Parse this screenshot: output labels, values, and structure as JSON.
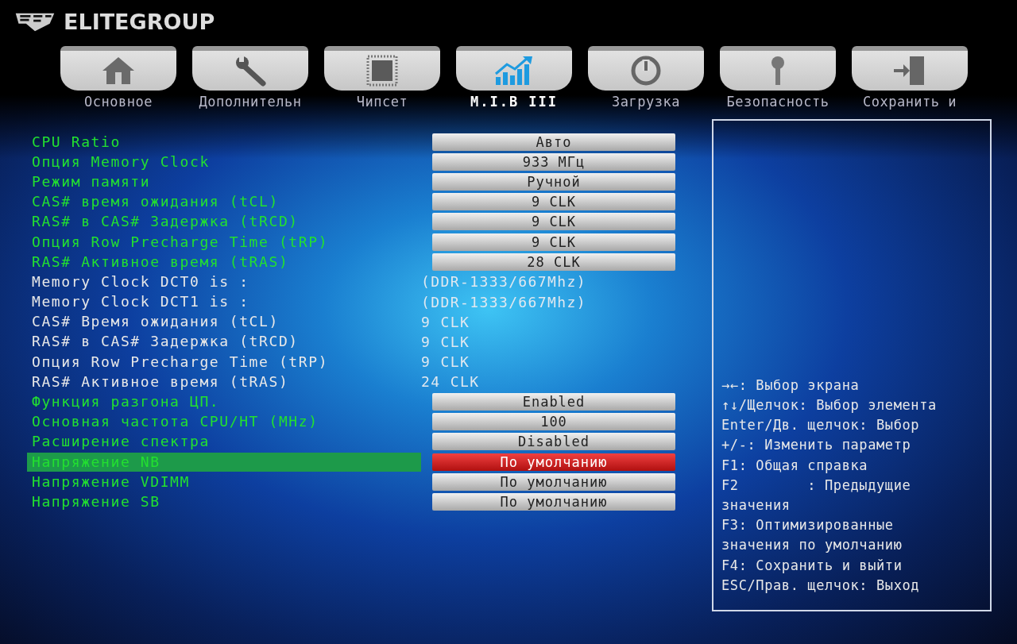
{
  "brand": {
    "name": "ELITEGROUP"
  },
  "tabs": [
    {
      "label": "Основное",
      "selected": false
    },
    {
      "label": "Дополнительн",
      "selected": false
    },
    {
      "label": "Чипсет",
      "selected": false
    },
    {
      "label": "M.I.B III",
      "selected": true
    },
    {
      "label": "Загрузка",
      "selected": false
    },
    {
      "label": "Безопасность",
      "selected": false
    },
    {
      "label": "Сохранить и",
      "selected": false
    }
  ],
  "settings": [
    {
      "kind": "option",
      "label": "CPU Ratio",
      "value": "Авто",
      "selected": false
    },
    {
      "kind": "option",
      "label": "Опция Memory Clock",
      "value": "933 МГц",
      "selected": false
    },
    {
      "kind": "option",
      "label": "Режим памяти",
      "value": "Ручной",
      "selected": false
    },
    {
      "kind": "option",
      "label": "CAS# время ожидания (tCL)",
      "value": "9 CLK",
      "selected": false
    },
    {
      "kind": "option",
      "label": "RAS# в CAS# Задержка (tRCD)",
      "value": "9 CLK",
      "selected": false
    },
    {
      "kind": "option",
      "label": "Опция Row Precharge Time (tRP)",
      "value": "9 CLK",
      "selected": false
    },
    {
      "kind": "option",
      "label": "RAS# Активное время (tRAS)",
      "value": "28 CLK",
      "selected": false
    },
    {
      "kind": "info",
      "label": "Memory Clock DCT0 is :",
      "value": "(DDR-1333/667Mhz)",
      "selected": false
    },
    {
      "kind": "info",
      "label": "Memory Clock DCT1 is :",
      "value": "(DDR-1333/667Mhz)",
      "selected": false
    },
    {
      "kind": "info",
      "label": "CAS# Время ожидания (tCL)",
      "value": "9 CLK",
      "selected": false
    },
    {
      "kind": "info",
      "label": "RAS# в CAS# Задержка (tRCD)",
      "value": "9 CLK",
      "selected": false
    },
    {
      "kind": "info",
      "label": "Опция Row Precharge Time (tRP)",
      "value": "9 CLK",
      "selected": false
    },
    {
      "kind": "info",
      "label": "RAS# Активное время (tRAS)",
      "value": "24 CLK",
      "selected": false
    },
    {
      "kind": "option",
      "label": "Функция разгона ЦП.",
      "value": "Enabled",
      "selected": false
    },
    {
      "kind": "option",
      "label": "Основная частота CPU/HT (MHz)",
      "value": "100",
      "selected": false
    },
    {
      "kind": "option",
      "label": "Расширение спектра",
      "value": "Disabled",
      "selected": false
    },
    {
      "kind": "option",
      "label": "Напряжение NB",
      "value": "По умолчанию",
      "selected": true
    },
    {
      "kind": "option",
      "label": "Напряжение VDIMM",
      "value": "По умолчанию",
      "selected": false
    },
    {
      "kind": "option",
      "label": "Напряжение SB",
      "value": "По умолчанию",
      "selected": false
    }
  ],
  "help": [
    "→←: Выбор экрана",
    "↑↓/Щелчок: Выбор элемента",
    "Enter/Дв. щелчок: Выбор",
    "+/-: Изменить параметр",
    "F1: Общая справка",
    "F2        : Предыдущие",
    "значения",
    "F3: Оптимизированные",
    "значения по умолчанию",
    "F4: Сохранить и выйти",
    "ESC/Прав. щелчок: Выход"
  ]
}
